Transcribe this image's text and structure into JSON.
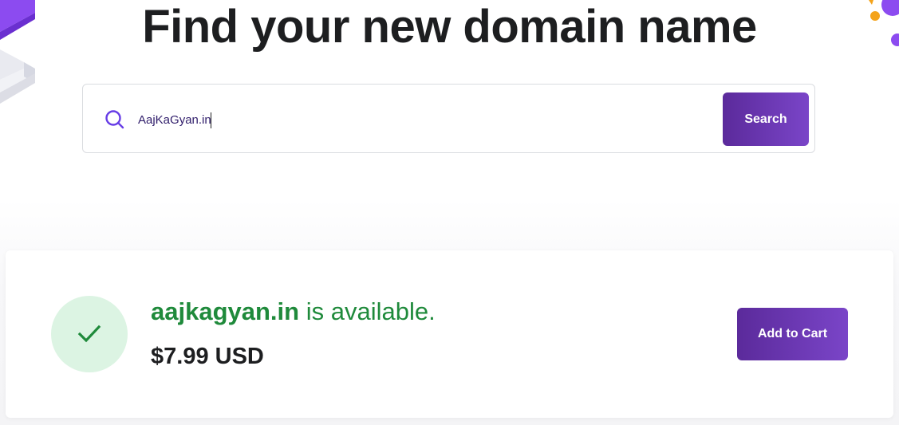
{
  "hero": {
    "title": "Find your new domain name"
  },
  "search": {
    "value": "AajKaGyan.in",
    "button_label": "Search",
    "icon": "search-icon"
  },
  "result": {
    "domain": "aajkagyan.in",
    "status_text": " is available.",
    "price": "$7.99 USD",
    "status_icon": "check-icon",
    "add_to_cart_label": "Add to Cart"
  },
  "colors": {
    "brand_purple": "#673de6",
    "button_gradient_start": "#5b2a9b",
    "button_gradient_end": "#7a45c8",
    "available_green": "#1f8a3b",
    "success_bg": "#dcf4e3",
    "text_dark": "#1d1e20"
  }
}
